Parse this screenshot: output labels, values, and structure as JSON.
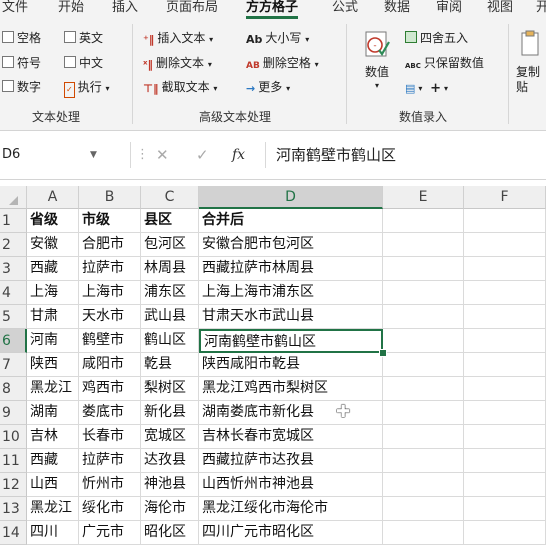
{
  "menu": [
    "文件",
    "开始",
    "插入",
    "页面布局",
    "方方格子",
    "公式",
    "数据",
    "审阅",
    "视图",
    "开"
  ],
  "ribbon": {
    "text_group": {
      "options": [
        "空格",
        "英文",
        "符号",
        "中文",
        "数字"
      ],
      "execute": "执行",
      "label": "文本处理"
    },
    "advanced_group": {
      "insert_text": "插入文本",
      "delete_text": "删除文本",
      "extract_text": "截取文本",
      "case": "大小写",
      "case_icon": "Ab",
      "delete_space": "删除空格",
      "delete_space_icon": "AB",
      "more": "更多",
      "label": "高级文本处理"
    },
    "number_group": {
      "value_button": "数值",
      "round": "四舍五入",
      "keep_value": "只保留数值",
      "keep_value_icon": "ABC",
      "label": "数值录入"
    },
    "copy_paste": "复制\n贴"
  },
  "formula_bar": {
    "name_box": "D6",
    "fx": "fx",
    "cancel": "✕",
    "confirm": "✓",
    "content": "河南鹤壁市鹤山区"
  },
  "sheet": {
    "columns": [
      "A",
      "B",
      "C",
      "D",
      "E",
      "F"
    ],
    "rows": [
      {
        "n": "1",
        "cells": [
          "省级",
          "市级",
          "县区",
          "合并后"
        ]
      },
      {
        "n": "2",
        "cells": [
          "安徽",
          "合肥市",
          "包河区",
          "安徽合肥市包河区"
        ]
      },
      {
        "n": "3",
        "cells": [
          "西藏",
          "拉萨市",
          "林周县",
          "西藏拉萨市林周县"
        ]
      },
      {
        "n": "4",
        "cells": [
          "上海",
          "上海市",
          "浦东区",
          "上海上海市浦东区"
        ]
      },
      {
        "n": "5",
        "cells": [
          "甘肃",
          "天水市",
          "武山县",
          "甘肃天水市武山县"
        ]
      },
      {
        "n": "6",
        "cells": [
          "河南",
          "鹤壁市",
          "鹤山区",
          "河南鹤壁市鹤山区"
        ]
      },
      {
        "n": "7",
        "cells": [
          "陕西",
          "咸阳市",
          "乾县",
          "陕西咸阳市乾县"
        ]
      },
      {
        "n": "8",
        "cells": [
          "黑龙江",
          "鸡西市",
          "梨树区",
          "黑龙江鸡西市梨树区"
        ]
      },
      {
        "n": "9",
        "cells": [
          "湖南",
          "娄底市",
          "新化县",
          "湖南娄底市新化县"
        ]
      },
      {
        "n": "10",
        "cells": [
          "吉林",
          "长春市",
          "宽城区",
          "吉林长春市宽城区"
        ]
      },
      {
        "n": "11",
        "cells": [
          "西藏",
          "拉萨市",
          "达孜县",
          "西藏拉萨市达孜县"
        ]
      },
      {
        "n": "12",
        "cells": [
          "山西",
          "忻州市",
          "神池县",
          "山西忻州市神池县"
        ]
      },
      {
        "n": "13",
        "cells": [
          "黑龙江",
          "绥化市",
          "海伦市",
          "黑龙江绥化市海伦市"
        ]
      },
      {
        "n": "14",
        "cells": [
          "四川",
          "广元市",
          "昭化区",
          "四川广元市昭化区"
        ]
      }
    ],
    "active_row": 6,
    "active_col": "D"
  },
  "colors": {
    "accent": "#217346",
    "ribbon_bg": "#f3f3f3"
  }
}
